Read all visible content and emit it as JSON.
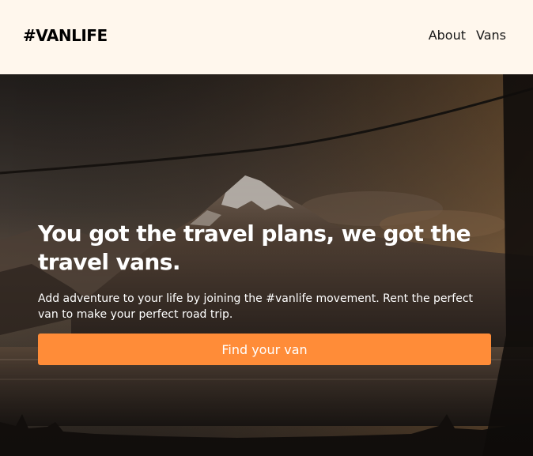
{
  "header": {
    "logo": "#VANLIFE",
    "nav": [
      {
        "label": "About"
      },
      {
        "label": "Vans"
      }
    ]
  },
  "hero": {
    "title": "You got the travel plans, we got the travel vans.",
    "subtitle": "Add adventure to your life by joining the #vanlife movement. Rent the perfect van to make your perfect road trip.",
    "cta_label": "Find your van"
  },
  "colors": {
    "header_bg": "#FFF7ED",
    "accent": "#FF8C38",
    "text_dark": "#161616",
    "text_light": "#FFFFFF"
  }
}
